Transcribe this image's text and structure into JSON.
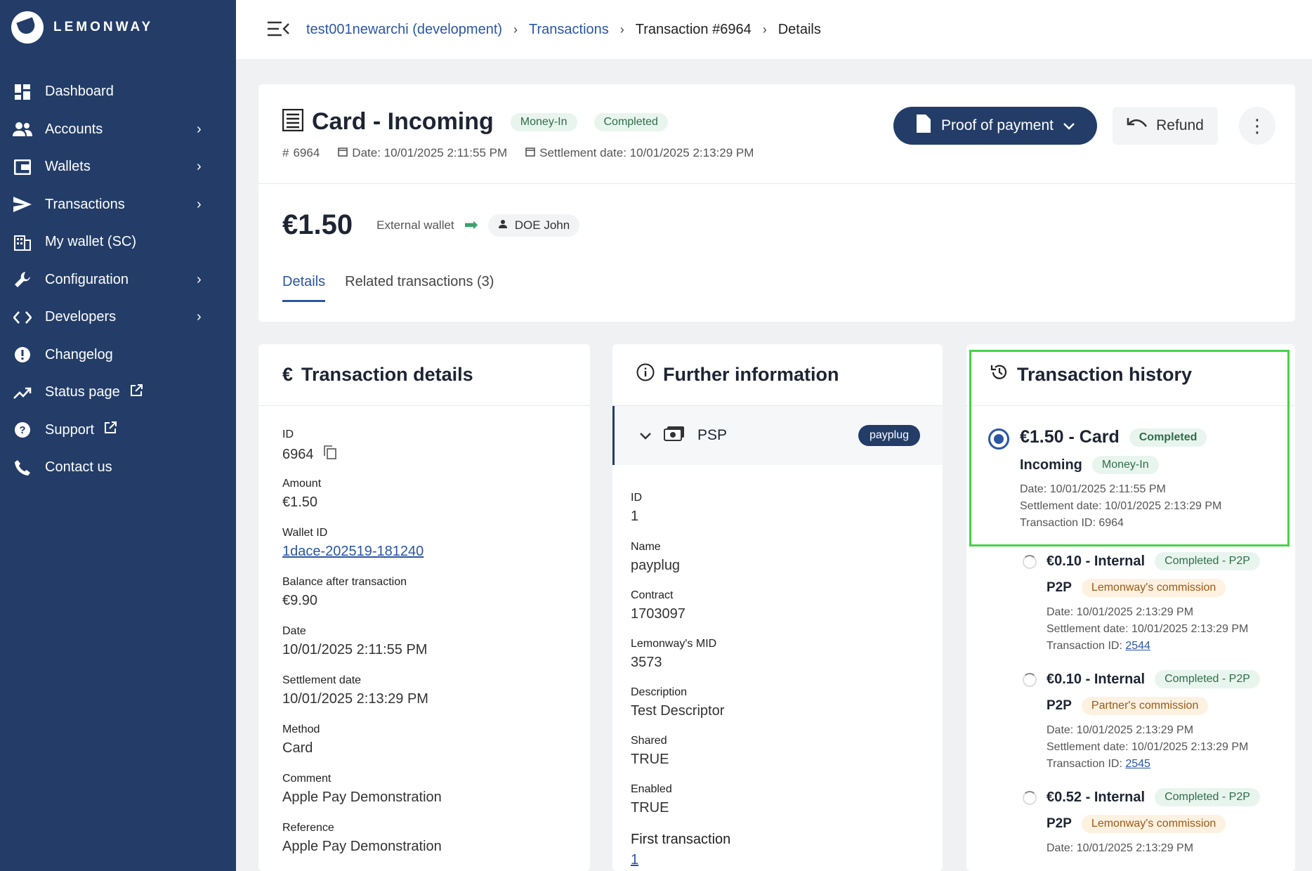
{
  "brand": {
    "name": "LEMONWAY"
  },
  "sidebar": {
    "items": [
      {
        "label": "Dashboard",
        "icon": "dashboard-icon",
        "has_children": false
      },
      {
        "label": "Accounts",
        "icon": "users-icon",
        "has_children": true
      },
      {
        "label": "Wallets",
        "icon": "wallet-icon",
        "has_children": true
      },
      {
        "label": "Transactions",
        "icon": "send-icon",
        "has_children": true
      },
      {
        "label": "My wallet (SC)",
        "icon": "building-icon",
        "has_children": false
      },
      {
        "label": "Configuration",
        "icon": "wrench-icon",
        "has_children": true
      },
      {
        "label": "Developers",
        "icon": "code-icon",
        "has_children": true
      },
      {
        "label": "Changelog",
        "icon": "alert-icon",
        "has_children": false
      },
      {
        "label": "Status page",
        "icon": "trend-icon",
        "has_children": false,
        "external": true
      },
      {
        "label": "Support",
        "icon": "help-icon",
        "has_children": false,
        "external": true
      },
      {
        "label": "Contact us",
        "icon": "phone-icon",
        "has_children": false
      }
    ]
  },
  "breadcrumb": {
    "account": "test001newarchi (development)",
    "section": "Transactions",
    "transaction": "Transaction #6964",
    "page": "Details"
  },
  "header": {
    "title": "Card - Incoming",
    "badge_type": "Money-In",
    "badge_status": "Completed",
    "id": "6964",
    "date": "Date: 10/01/2025 2:11:55 PM",
    "settlement": "Settlement date: 10/01/2025 2:13:29 PM",
    "proof_label": "Proof of payment",
    "refund_label": "Refund",
    "amount": "€1.50",
    "from": "External wallet",
    "to": "DOE John",
    "tabs": [
      "Details",
      "Related transactions (3)"
    ]
  },
  "details": {
    "title": "Transaction details",
    "fields": [
      {
        "label": "ID",
        "value": "6964"
      },
      {
        "label": "Amount",
        "value": "€1.50"
      },
      {
        "label": "Wallet ID",
        "value": "1dace-202519-181240"
      },
      {
        "label": "Balance after transaction",
        "value": "€9.90"
      },
      {
        "label": "Date",
        "value": "10/01/2025 2:11:55 PM"
      },
      {
        "label": "Settlement date",
        "value": "10/01/2025 2:13:29 PM"
      },
      {
        "label": "Method",
        "value": "Card"
      },
      {
        "label": "Comment",
        "value": "Apple Pay Demonstration"
      },
      {
        "label": "Reference",
        "value": "Apple Pay Demonstration"
      }
    ]
  },
  "further": {
    "title": "Further information",
    "psp_label": "PSP",
    "psp_badge": "payplug",
    "fields": [
      {
        "label": "ID",
        "value": "1"
      },
      {
        "label": "Name",
        "value": "payplug"
      },
      {
        "label": "Contract",
        "value": "1703097"
      },
      {
        "label": "Lemonway's MID",
        "value": "3573"
      },
      {
        "label": "Description",
        "value": "Test Descriptor"
      },
      {
        "label": "Shared",
        "value": "TRUE"
      },
      {
        "label": "Enabled",
        "value": "TRUE"
      },
      {
        "label": "First transaction",
        "value": "1"
      }
    ]
  },
  "history": {
    "title": "Transaction history",
    "main": {
      "title": "€1.50 - Card",
      "status": "Completed",
      "sub": "Incoming",
      "type": "Money-In",
      "date": "Date: 10/01/2025 2:11:55 PM",
      "settlement": "Settlement date: 10/01/2025 2:13:29 PM",
      "tx": "Transaction ID: 6964"
    },
    "entries": [
      {
        "title": "€0.10 - Internal",
        "status": "Completed - P2P",
        "sub": "P2P",
        "type": "Lemonway's commission",
        "date": "Date: 10/01/2025 2:13:29 PM",
        "settlement": "Settlement date: 10/01/2025 2:13:29 PM",
        "tx_label": "Transaction ID:",
        "tx_id": "2544"
      },
      {
        "title": "€0.10 - Internal",
        "status": "Completed - P2P",
        "sub": "P2P",
        "type": "Partner's commission",
        "date": "Date: 10/01/2025 2:13:29 PM",
        "settlement": "Settlement date: 10/01/2025 2:13:29 PM",
        "tx_label": "Transaction ID:",
        "tx_id": "2545"
      },
      {
        "title": "€0.52 - Internal",
        "status": "Completed - P2P",
        "sub": "P2P",
        "type": "Lemonway's commission",
        "date": "Date: 10/01/2025 2:13:29 PM"
      }
    ]
  }
}
